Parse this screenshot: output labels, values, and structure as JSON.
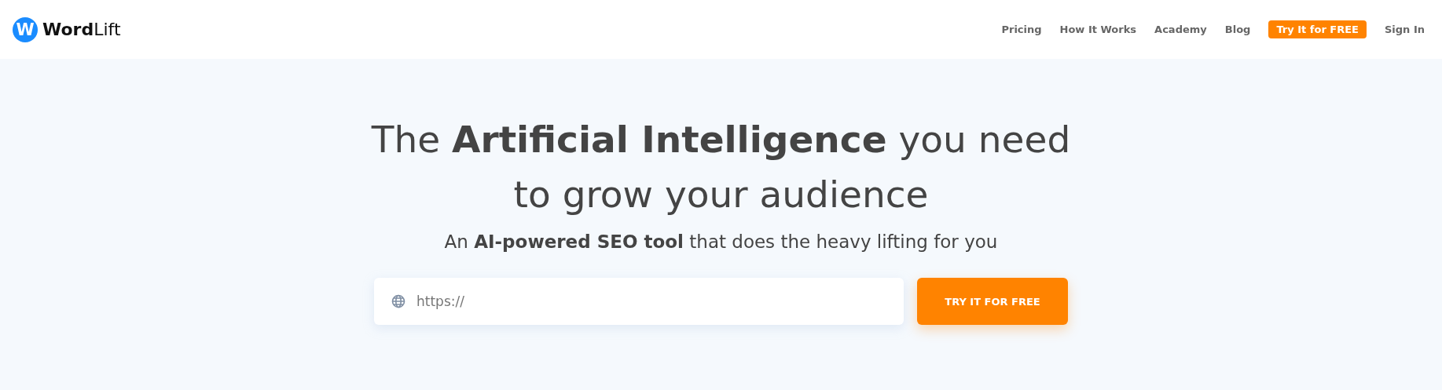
{
  "header": {
    "logo": {
      "mark": "W",
      "name": "**Word**Lift"
    },
    "nav": [
      {
        "label": "Pricing",
        "kind": "link"
      },
      {
        "label": "How It Works",
        "kind": "link"
      },
      {
        "label": "Academy",
        "kind": "link"
      },
      {
        "label": "Blog",
        "kind": "link"
      },
      {
        "label": "Try It for FREE",
        "kind": "cta"
      },
      {
        "label": "Sign In",
        "kind": "link"
      }
    ]
  },
  "hero": {
    "headline": "The **Artificial Intelligence** you need to grow your audience",
    "subtitle": "An **AI-powered SEO tool** that does the heavy lifting for you",
    "url_field": {
      "placeholder": "https://"
    },
    "button": "TRY IT FOR FREE"
  }
}
